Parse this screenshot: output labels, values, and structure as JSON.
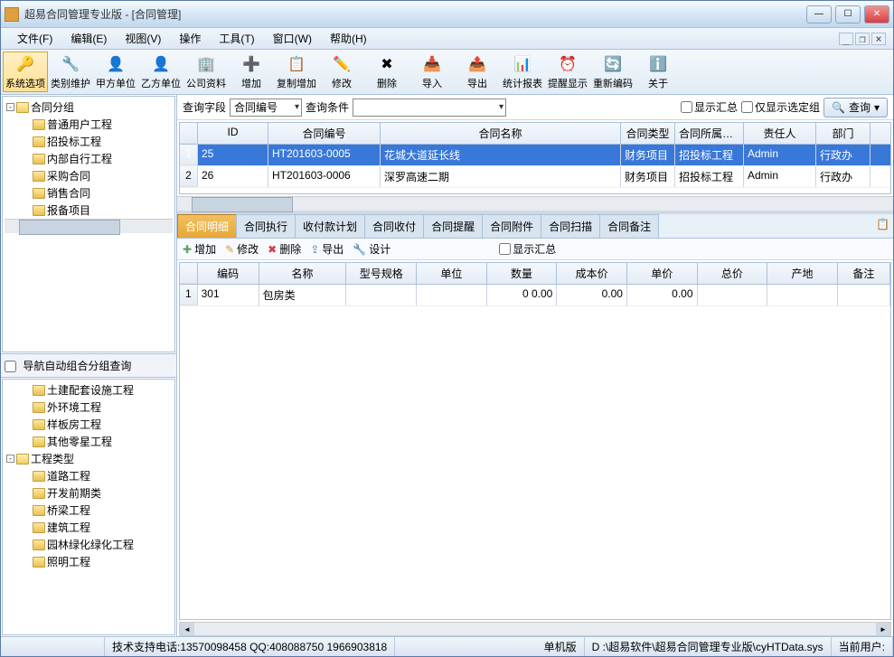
{
  "window": {
    "title": "超易合同管理专业版 - [合同管理]"
  },
  "menubar": {
    "file": "文件(F)",
    "edit": "编辑(E)",
    "view": "视图(V)",
    "operate": "操作",
    "tool": "工具(T)",
    "window": "窗口(W)",
    "help": "帮助(H)"
  },
  "toolbar": {
    "items": [
      {
        "label": "系统选项",
        "icon": "🔑",
        "active": true
      },
      {
        "label": "类别维护",
        "icon": "🔧"
      },
      {
        "label": "甲方单位",
        "icon": "👤"
      },
      {
        "label": "乙方单位",
        "icon": "👤"
      },
      {
        "label": "公司资料",
        "icon": "🏢"
      },
      {
        "label": "增加",
        "icon": "➕"
      },
      {
        "label": "复制增加",
        "icon": "📋"
      },
      {
        "label": "修改",
        "icon": "✏️"
      },
      {
        "label": "删除",
        "icon": "✖"
      },
      {
        "label": "导入",
        "icon": "📥"
      },
      {
        "label": "导出",
        "icon": "📤"
      },
      {
        "label": "统计报表",
        "icon": "📊"
      },
      {
        "label": "提醒显示",
        "icon": "⏰"
      },
      {
        "label": "重新编码",
        "icon": "🔄"
      },
      {
        "label": "关于",
        "icon": "ℹ️"
      }
    ]
  },
  "tree1": {
    "root": "合同分组",
    "items": [
      "普通用户工程",
      "招投标工程",
      "内部自行工程",
      "采购合同",
      "销售合同",
      "报备项目"
    ]
  },
  "tree2_label": "导航自动组合分组查询",
  "tree2": {
    "group1_items": [
      "土建配套设施工程",
      "外环境工程",
      "样板房工程",
      "其他零星工程"
    ],
    "root2": "工程类型",
    "group2_items": [
      "道路工程",
      "开发前期类",
      "桥梁工程",
      "建筑工程",
      "园林绿化绿化工程",
      "照明工程"
    ]
  },
  "search": {
    "field_label": "查询字段",
    "field_value": "合同编号",
    "cond_label": "查询条件",
    "show_summary": "显示汇总",
    "only_selected": "仅显示选定组",
    "btn": "查询"
  },
  "grid": {
    "headers": {
      "idx": "",
      "id": "ID",
      "num": "合同编号",
      "name": "合同名称",
      "type": "合同类型",
      "group": "合同所属分组",
      "resp": "责任人",
      "dept": "部门"
    },
    "rows": [
      {
        "idx": "1",
        "id": "25",
        "num": "HT201603-0005",
        "name": "花城大道延长线",
        "type": "财务项目",
        "group": "招投标工程",
        "resp": "Admin",
        "dept": "行政办",
        "selected": true
      },
      {
        "idx": "2",
        "id": "26",
        "num": "HT201603-0006",
        "name": "深罗高速二期",
        "type": "财务项目",
        "group": "招投标工程",
        "resp": "Admin",
        "dept": "行政办",
        "selected": false
      }
    ]
  },
  "tabs": {
    "items": [
      "合同明细",
      "合同执行",
      "收付款计划",
      "合同收付",
      "合同提醒",
      "合同附件",
      "合同扫描",
      "合同备注"
    ]
  },
  "detail_toolbar": {
    "add": "增加",
    "edit": "修改",
    "del": "删除",
    "export": "导出",
    "design": "设计",
    "show_summary": "显示汇总"
  },
  "detail_grid": {
    "headers": {
      "code": "编码",
      "name": "名称",
      "spec": "型号规格",
      "unit": "单位",
      "qty": "数量",
      "cost": "成本价",
      "price": "单价",
      "total": "总价",
      "origin": "产地",
      "note": "备注"
    },
    "rows": [
      {
        "idx": "1",
        "code": "301",
        "name": "包房类",
        "spec": "",
        "unit": "",
        "qty": "0 0.00",
        "cost": "0.00",
        "price": "0.00",
        "total": "",
        "origin": "",
        "note": ""
      }
    ]
  },
  "status": {
    "support": "技术支持电话:13570098458 QQ:408088750 1966903818",
    "version": "单机版",
    "path": "D :\\超易软件\\超易合同管理专业版\\cyHTData.sys",
    "user_label": "当前用户:"
  }
}
